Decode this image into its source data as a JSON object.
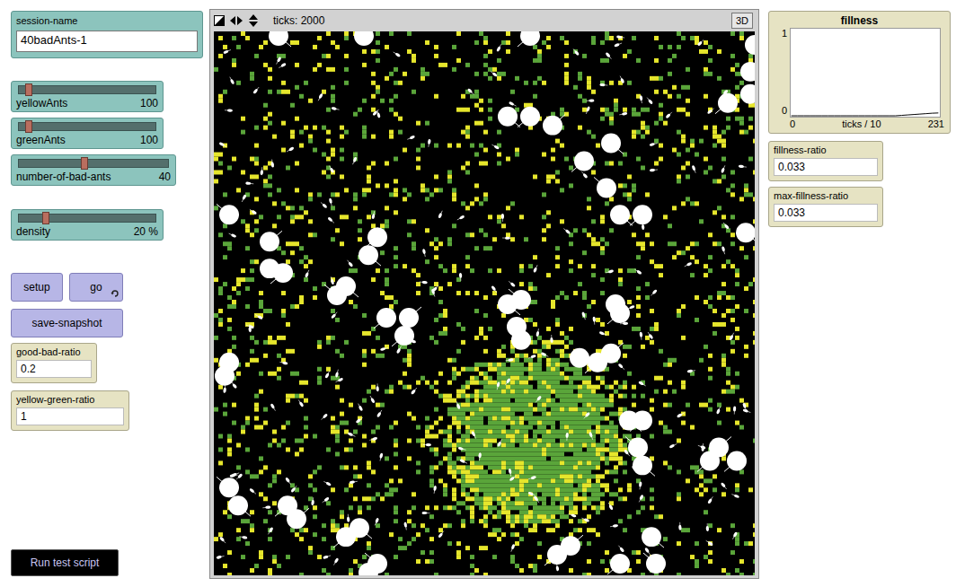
{
  "session_input": {
    "label": "session-name",
    "value": "40badAnts-1"
  },
  "sliders": [
    {
      "name": "yellowAnts",
      "reading": "100",
      "level": 0.07
    },
    {
      "name": "greenAnts",
      "reading": "100",
      "level": 0.07
    },
    {
      "name": "number-of-bad-ants",
      "reading": "40",
      "level": 0.44
    },
    {
      "name": "density",
      "reading": "20 %",
      "level": 0.2
    }
  ],
  "buttons": [
    {
      "label": "setup",
      "forever": false
    },
    {
      "label": "go",
      "forever": true
    },
    {
      "label": "save-snapshot",
      "forever": false
    }
  ],
  "monitors": [
    {
      "label": "good-bad-ratio",
      "value": "0.2"
    },
    {
      "label": "yellow-green-ratio",
      "value": "1"
    }
  ],
  "test_button": {
    "label": "Run test script"
  },
  "view": {
    "ticks": "ticks: 2000",
    "button_3d": "3D",
    "patch_kinds": [
      {
        "kind": "yellow",
        "color": "#e6e62c"
      },
      {
        "kind": "green",
        "color": "#5aa53a"
      }
    ]
  },
  "plot": {
    "title": "fillness",
    "y_max": "1",
    "y_min": "0",
    "x_min": "0",
    "x_label": "ticks / 10",
    "x_max": "231",
    "series": [
      {
        "name": "fillness",
        "color": "#000000",
        "values": [
          0,
          0,
          0,
          0,
          0,
          0,
          0,
          0,
          0,
          0,
          0,
          0,
          0,
          0,
          0,
          0,
          0,
          0,
          0.005,
          0.01,
          0.015,
          0.02,
          0.025,
          0.03,
          0.033
        ]
      }
    ]
  },
  "right_monitors": [
    {
      "label": "fillness-ratio",
      "value": "0.033"
    },
    {
      "label": "max-fillness-ratio",
      "value": "0.033"
    }
  ]
}
